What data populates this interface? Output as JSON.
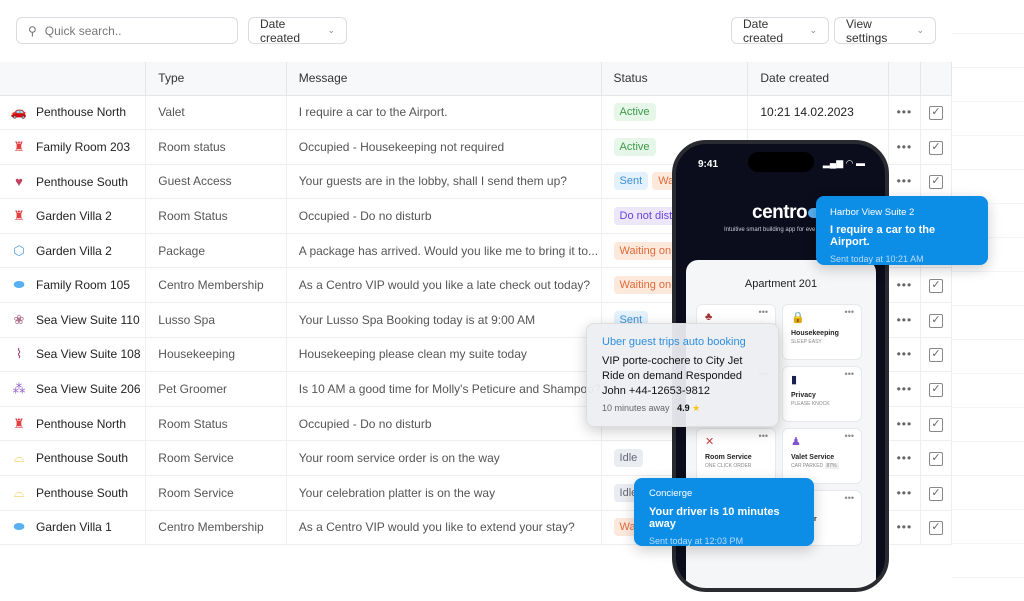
{
  "toolbar": {
    "search_placeholder": "Quick search..",
    "left_filter": "Date created",
    "right_filter": "Date created",
    "view_settings": "View settings"
  },
  "columns": [
    "",
    "Type",
    "Message",
    "Status",
    "Date created"
  ],
  "rows": [
    {
      "icon": "valet-icon",
      "icon_glyph": "🚗",
      "icon_color": "#4a9be0",
      "name": "Penthouse North",
      "type": "Valet",
      "message": "I require a car to the Airport.",
      "status": [
        "Active"
      ],
      "date": "10:21 14.02.2023"
    },
    {
      "icon": "bellhop-icon",
      "icon_glyph": "♜",
      "icon_color": "#e04040",
      "name": "Family Room 203",
      "type": "Room status",
      "message": "Occupied - Housekeeping not required",
      "status": [
        "Active"
      ],
      "date": ""
    },
    {
      "icon": "hand-heart-icon",
      "icon_glyph": "♥",
      "icon_color": "#c04060",
      "name": "Penthouse South",
      "type": "Guest Access",
      "message": "Your guests are in the lobby, shall I send them up?",
      "status": [
        "Sent",
        "Waiting on reply"
      ],
      "date": ""
    },
    {
      "icon": "bellhop-icon",
      "icon_glyph": "♜",
      "icon_color": "#e04040",
      "name": "Garden Villa 2",
      "type": "Room Status",
      "message": "Occupied - Do no disturb",
      "status": [
        "Do not disturb"
      ],
      "date": ""
    },
    {
      "icon": "package-icon",
      "icon_glyph": "⬡",
      "icon_color": "#4a9be0",
      "name": "Garden Villa 2",
      "type": "Package",
      "message": "A package has arrived. Would you like me to bring it to...",
      "status": [
        "Waiting on reply"
      ],
      "date": ""
    },
    {
      "icon": "centro-toggle-icon",
      "icon_glyph": "⬬",
      "icon_color": "#58b0f0",
      "name": "Family Room 105",
      "type": "Centro Membership",
      "message": "As a Centro VIP would you like a late check out today?",
      "status": [
        "Waiting on reply"
      ],
      "date": ""
    },
    {
      "icon": "lotus-icon",
      "icon_glyph": "❀",
      "icon_color": "#b07090",
      "name": "Sea View Suite 110",
      "type": "Lusso Spa",
      "message": "Your Lusso Spa Booking today is at 9:00 AM",
      "status": [
        "Sent"
      ],
      "date": ""
    },
    {
      "icon": "broom-icon",
      "icon_glyph": "⌇",
      "icon_color": "#a04070",
      "name": "Sea View Suite 108",
      "type": "Housekeeping",
      "message": "Housekeeping please clean my suite today",
      "status": [],
      "date": ""
    },
    {
      "icon": "paw-icon",
      "icon_glyph": "⁂",
      "icon_color": "#9060c0",
      "name": "Sea View Suite 206",
      "type": "Pet Groomer",
      "message": "Is 10 AM a good time for Molly's Peticure and Shampoo?",
      "status": [],
      "date": ""
    },
    {
      "icon": "bellhop-icon",
      "icon_glyph": "♜",
      "icon_color": "#e04040",
      "name": "Penthouse North",
      "type": "Room Status",
      "message": "Occupied - Do no disturb",
      "status": [],
      "date": ""
    },
    {
      "icon": "service-bell-icon",
      "icon_glyph": "⌓",
      "icon_color": "#f0c030",
      "name": "Penthouse South",
      "type": "Room Service",
      "message": "Your room service order is on the way",
      "status": [
        "Idle"
      ],
      "date": ""
    },
    {
      "icon": "service-bell-icon",
      "icon_glyph": "⌓",
      "icon_color": "#f0c030",
      "name": "Penthouse South",
      "type": "Room Service",
      "message": "Your celebration platter is on the way",
      "status": [
        "Idle"
      ],
      "date": ""
    },
    {
      "icon": "centro-toggle-icon",
      "icon_glyph": "⬬",
      "icon_color": "#58b0f0",
      "name": "Garden Villa 1",
      "type": "Centro Membership",
      "message": "As a Centro VIP would you like to extend your stay?",
      "status": [
        "Waiting"
      ],
      "date": ""
    }
  ],
  "phone": {
    "time": "9:41",
    "logo": "centro",
    "tagline": "Intuitive smart building app for eve",
    "card_title": "Apartment 201",
    "tiles": [
      {
        "title": "",
        "sub": "",
        "glyph": "♣",
        "color": "#a03030"
      },
      {
        "title": "Housekeeping",
        "sub": "SLEEP EASY",
        "glyph": "🔒",
        "color": "#2a9a50"
      },
      {
        "title": "",
        "sub": "",
        "glyph": "",
        "color": "#333"
      },
      {
        "title": "Privacy",
        "sub": "PLEASE KNOCK",
        "glyph": "▮",
        "color": "#1a2050"
      },
      {
        "title": "Room Service",
        "sub": "ONE CLICK ORDER",
        "glyph": "✕",
        "color": "#d04040"
      },
      {
        "title": "Valet Service",
        "sub": "CAR PARKED",
        "badge": "87%",
        "glyph": "♟",
        "color": "#8050d0"
      },
      {
        "title": "",
        "sub": "",
        "glyph": "",
        "color": "#333"
      },
      {
        "title": "ditioner",
        "sub": "",
        "glyph": "",
        "color": "#333"
      }
    ]
  },
  "notifications": {
    "harbor": {
      "title": "Harbor View Suite 2",
      "message": "I require a car to the Airport.",
      "time": "Sent today at 10:21 AM"
    },
    "uber": {
      "title": "Uber guest trips auto booking",
      "line1": "VIP porte-cochere to City Jet",
      "line2": "Ride on demand Responded",
      "line3": "John +44-12653-9812",
      "eta": "10 minutes away",
      "rating": "4.9"
    },
    "concierge": {
      "title": "Concierge",
      "message": "Your driver is 10 minutes away",
      "time": "Sent today at 12:03 PM"
    }
  },
  "colors": {
    "accent": "#0c8de6",
    "phone_bg": "#0b0d1c"
  }
}
